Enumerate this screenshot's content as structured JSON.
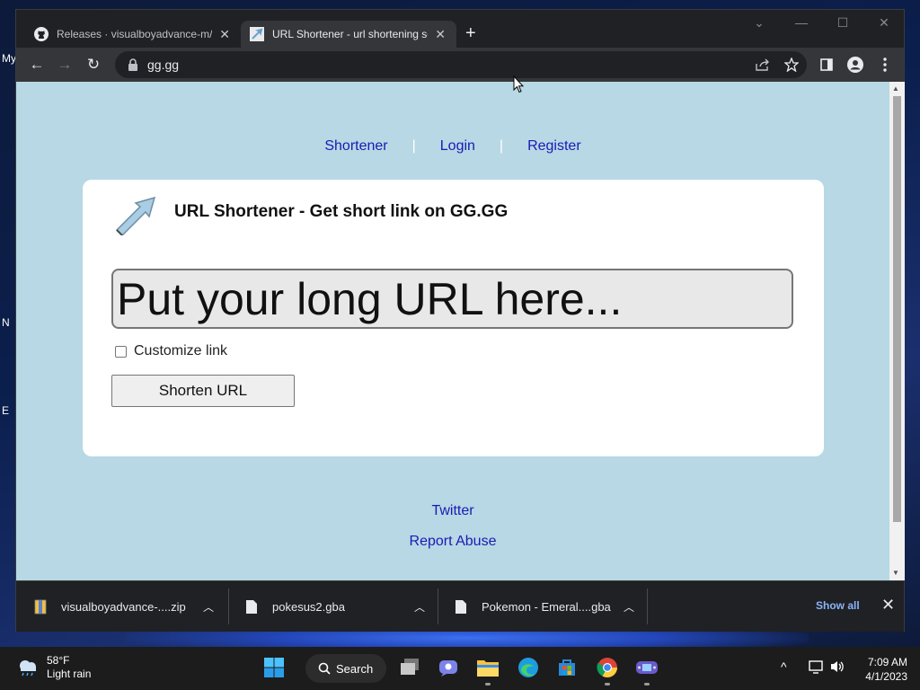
{
  "desktop": {
    "icon_labels": [
      "My",
      "N",
      "E"
    ]
  },
  "browser": {
    "tabs": [
      {
        "title": "Releases · visualboyadvance-m/visualboyadvance-m",
        "close": "✕"
      },
      {
        "title": "URL Shortener - url shortening service",
        "close": "✕"
      }
    ],
    "new_tab": "+",
    "window_controls": {
      "dropdown": "⌄",
      "minimize": "—",
      "maximize": "☐",
      "close": "✕"
    },
    "toolbar": {
      "back": "←",
      "forward": "→",
      "reload": "↻",
      "address": "gg.gg"
    }
  },
  "page": {
    "nav": {
      "shortener": "Shortener",
      "separator": "|",
      "login": "Login",
      "register": "Register"
    },
    "card": {
      "title": "URL Shortener - Get short link on GG.GG",
      "input_placeholder": "Put your long URL here...",
      "customize_label": "Customize link",
      "customize_checked": false,
      "button_label": "Shorten URL"
    },
    "footer": {
      "twitter": "Twitter",
      "report": "Report Abuse"
    }
  },
  "downloads": {
    "items": [
      {
        "name": "visualboyadvance-....zip"
      },
      {
        "name": "pokesus2.gba"
      },
      {
        "name": "Pokemon - Emeral....gba"
      }
    ],
    "show_all": "Show all",
    "close": "✕"
  },
  "taskbar": {
    "weather": {
      "temp": "58°F",
      "condition": "Light rain"
    },
    "search_label": "Search",
    "clock": {
      "time": "7:09 AM",
      "date": "4/1/2023"
    },
    "tray_chevron": "^"
  },
  "colors": {
    "page_bg": "#b7d8e4",
    "link": "#1a1ab5",
    "chrome_dark": "#202124",
    "chrome_toolbar": "#35363a",
    "show_all": "#8ab4f8"
  }
}
